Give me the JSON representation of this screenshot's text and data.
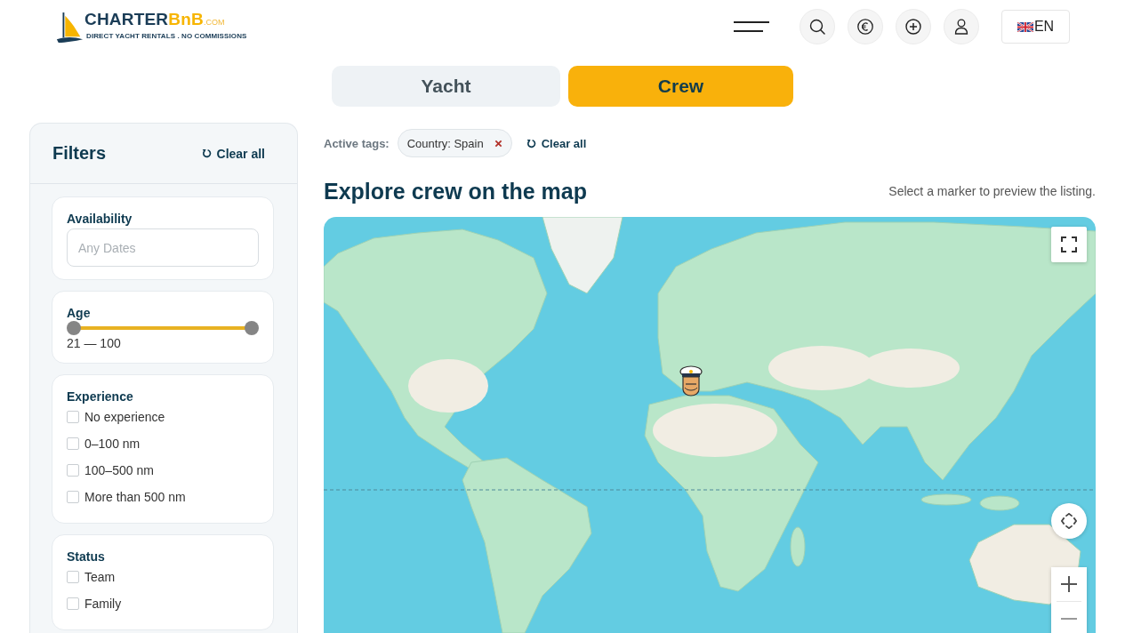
{
  "header": {
    "logo": {
      "wordmark": "CHARTER",
      "wordmark_accent": "BnB",
      "domain": ".COM",
      "tagline": "DIRECT YACHT RENTALS . NO COMMISSIONS"
    },
    "language": "EN"
  },
  "tabs": [
    {
      "label": "Yacht",
      "selected": false
    },
    {
      "label": "Crew",
      "selected": true
    }
  ],
  "filters": {
    "title": "Filters",
    "clear_label": "Clear all",
    "sections": [
      {
        "kind": "date",
        "title": "Availability",
        "placeholder": "Any Dates"
      },
      {
        "kind": "range",
        "title": "Age",
        "thumbs": [
          {
            "level": 0
          },
          {
            "level": 1
          }
        ],
        "reading": "21 — 100"
      },
      {
        "kind": "checklist",
        "title": "Experience",
        "options": [
          {
            "label": "No experience",
            "checked": false
          },
          {
            "label": "0–100 nm",
            "checked": false
          },
          {
            "label": "100–500 nm",
            "checked": false
          },
          {
            "label": "More than 500 nm",
            "checked": false
          }
        ]
      },
      {
        "kind": "checklist",
        "title": "Status",
        "options": [
          {
            "label": "Team",
            "checked": false
          },
          {
            "label": "Family",
            "checked": false
          }
        ]
      }
    ]
  },
  "active_tags": {
    "label": "Active tags:",
    "tags": [
      {
        "label": "Country: Spain"
      }
    ],
    "clear_label": "Clear all"
  },
  "map_section": {
    "title": "Explore crew on the map",
    "hint": "Select a marker to preview the listing."
  }
}
